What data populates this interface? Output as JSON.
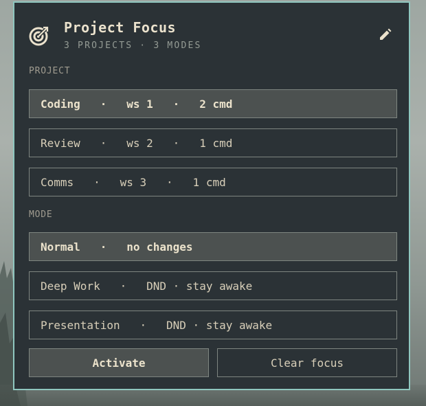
{
  "widget": {
    "title": "Project Focus",
    "subtitle": "3 PROJECTS · 3 MODES",
    "icon": "target-icon",
    "edit_icon": "pencil-icon"
  },
  "projects": {
    "label": "PROJECT",
    "items": [
      {
        "label": "Coding   ·   ws 1   ·   2 cmd",
        "selected": true
      },
      {
        "label": "Review   ·   ws 2   ·   1 cmd",
        "selected": false
      },
      {
        "label": "Comms   ·   ws 3   ·   1 cmd",
        "selected": false
      }
    ]
  },
  "modes": {
    "label": "MODE",
    "items": [
      {
        "label": "Normal   ·   no changes",
        "selected": true
      },
      {
        "label": "Deep Work   ·   DND · stay awake",
        "selected": false
      },
      {
        "label": "Presentation   ·   DND · stay awake",
        "selected": false
      }
    ]
  },
  "actions": {
    "activate_label": "Activate",
    "clear_label": "Clear focus"
  },
  "colors": {
    "panel_bg": "#2b3236",
    "panel_border": "#8fc7bf",
    "text_primary": "#ebe2cd",
    "selected_bg": "#4c5150"
  }
}
